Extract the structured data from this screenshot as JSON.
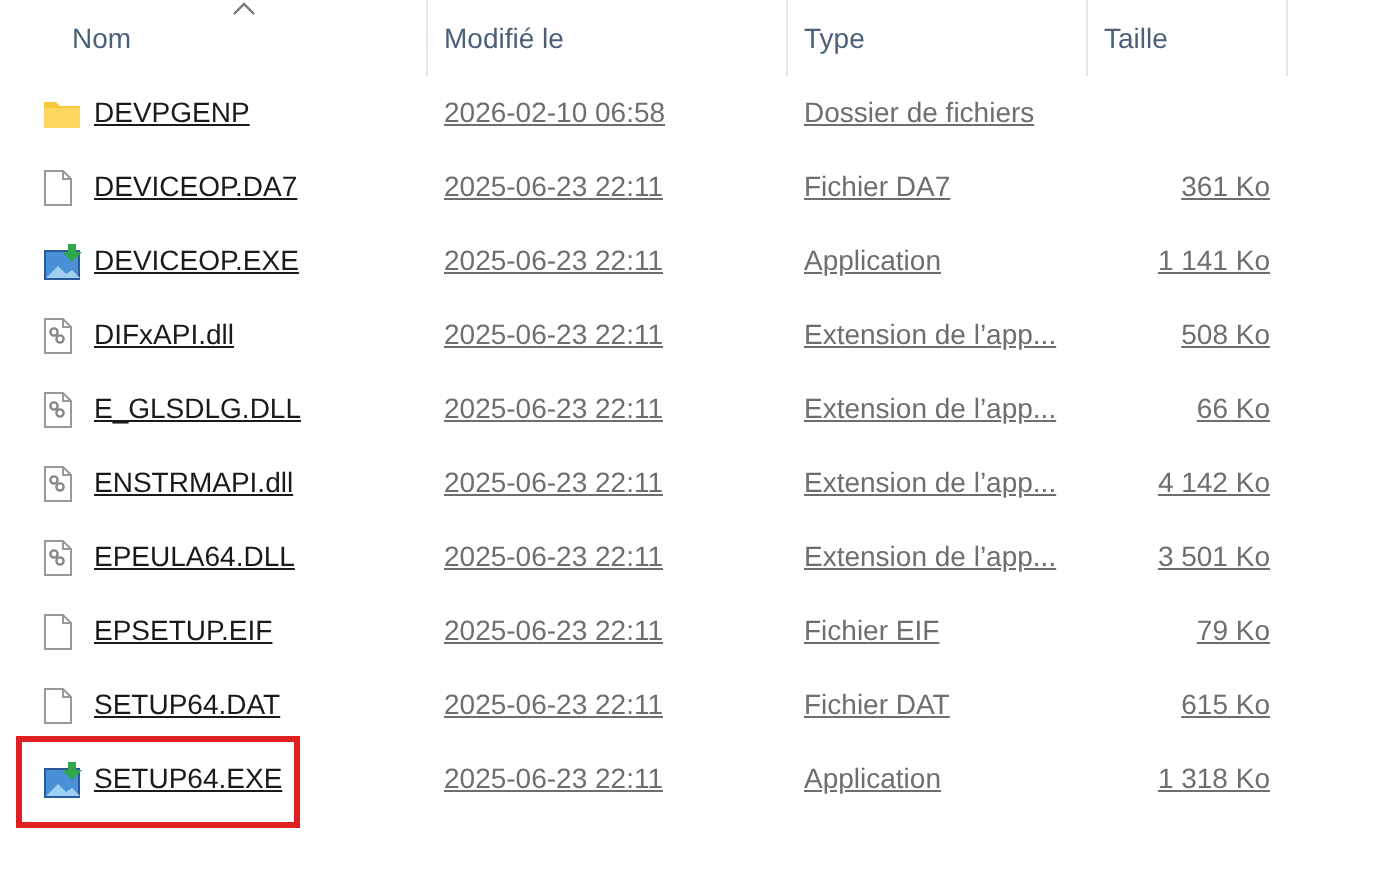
{
  "columns": [
    {
      "label": "Nom",
      "sorted": true
    },
    {
      "label": "Modifié le",
      "sorted": false
    },
    {
      "label": "Type",
      "sorted": false
    },
    {
      "label": "Taille",
      "sorted": false
    }
  ],
  "files": [
    {
      "kind": "folder",
      "name": "DEVPGENP",
      "modified": "2026-02-10 06:58",
      "type": "Dossier de fichiers",
      "highlighted": false
    },
    {
      "kind": "file",
      "name": "DEVICEOP.DA7",
      "modified": "2025-06-23 22:11",
      "type": "Fichier DA7",
      "size": "361 Ko",
      "highlighted": false
    },
    {
      "kind": "exe",
      "name": "DEVICEOP.EXE",
      "modified": "2025-06-23 22:11",
      "type": "Application",
      "size": "1 141 Ko",
      "highlighted": false
    },
    {
      "kind": "dll",
      "name": "DIFxAPI.dll",
      "modified": "2025-06-23 22:11",
      "type": "Extension de l’app...",
      "size": "508 Ko",
      "highlighted": false
    },
    {
      "kind": "dll",
      "name": "E_GLSDLG.DLL",
      "modified": "2025-06-23 22:11",
      "type": "Extension de l’app...",
      "size": "66 Ko",
      "highlighted": false
    },
    {
      "kind": "dll",
      "name": "ENSTRMAPI.dll",
      "modified": "2025-06-23 22:11",
      "type": "Extension de l’app...",
      "size": "4 142 Ko",
      "highlighted": false
    },
    {
      "kind": "dll",
      "name": "EPEULA64.DLL",
      "modified": "2025-06-23 22:11",
      "type": "Extension de l’app...",
      "size": "3 501 Ko",
      "highlighted": false
    },
    {
      "kind": "file",
      "name": "EPSETUP.EIF",
      "modified": "2025-06-23 22:11",
      "type": "Fichier EIF",
      "size": "79 Ko",
      "highlighted": false
    },
    {
      "kind": "file",
      "name": "SETUP64.DAT",
      "modified": "2025-06-23 22:11",
      "type": "Fichier DAT",
      "size": "615 Ko",
      "highlighted": false
    },
    {
      "kind": "exe",
      "name": "SETUP64.EXE",
      "modified": "2025-06-23 22:11",
      "type": "Application",
      "size": "1 318 Ko",
      "highlighted": true
    }
  ]
}
